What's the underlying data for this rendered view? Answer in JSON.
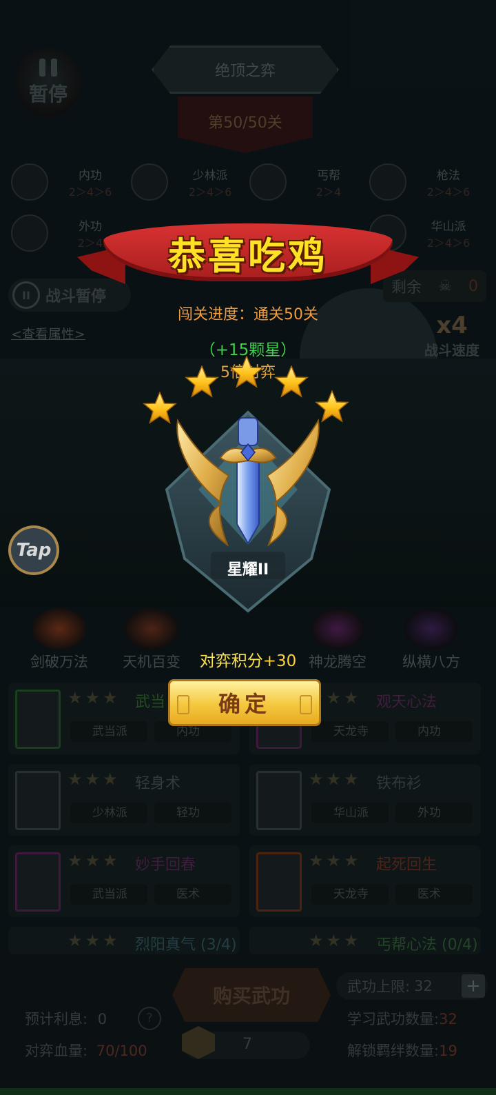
{
  "header": {
    "pause_label": "暂停",
    "mode_title": "绝顶之弈",
    "level": "第50/50关"
  },
  "bonds": [
    {
      "name": "内功",
      "levels": "2＞4＞6"
    },
    {
      "name": "少林派",
      "levels": "2＞4＞6"
    },
    {
      "name": "丐帮",
      "levels": "2＞4"
    },
    {
      "name": "枪法",
      "levels": "2＞4＞6"
    },
    {
      "name": "外功",
      "levels": "2＞4"
    },
    {
      "name": "华山派",
      "levels": "2＞4＞6"
    }
  ],
  "battle": {
    "pause_label": "战斗暂停",
    "view_attributes": "<查看属性>",
    "remaining_label": "剩余",
    "remaining_value": "0",
    "speed_value": "x4",
    "speed_label": "战斗速度",
    "tap_label": "Tap"
  },
  "skills": [
    {
      "name": "剑破万法",
      "color": "#6a3018"
    },
    {
      "name": "天机百变",
      "color": "#5a2a1a"
    },
    {
      "name": "神龙腾空",
      "color": "#4a1e4e"
    },
    {
      "name": "纵横八方",
      "color": "#36204e"
    }
  ],
  "cards": [
    {
      "title": "武当",
      "title_color": "#2a5a2a",
      "tags": [
        "武当派",
        "内功"
      ]
    },
    {
      "title": "观天心法",
      "title_color": "#4a2448",
      "tags": [
        "天龙寺",
        "内功"
      ]
    },
    {
      "title": "轻身术",
      "title_color": "#3a4445",
      "tags": [
        "少林派",
        "轻功"
      ]
    },
    {
      "title": "铁布衫",
      "title_color": "#3a4445",
      "tags": [
        "华山派",
        "外功"
      ]
    },
    {
      "title": "妙手回春",
      "title_color": "#4a2448",
      "tags": [
        "武当派",
        "医术"
      ]
    },
    {
      "title": "起死回生",
      "title_color": "#5a2a1e",
      "tags": [
        "天龙寺",
        "医术"
      ]
    },
    {
      "title": "烈阳真气 (3/4)",
      "title_color": "#2a4a50"
    },
    {
      "title": "丐帮心法 (0/4)",
      "title_color": "#2a5030"
    }
  ],
  "bottom": {
    "buy_label": "购买武功",
    "limit_label": "武功上限:",
    "limit_value": "32",
    "interest_label": "预计利息:",
    "interest_value": "0",
    "help_icon_label": "?",
    "hp_label": "对弈血量:",
    "hp_value": "70/100",
    "coins": "7",
    "learned_label": "学习武功数量:",
    "learned_value": "32",
    "bonds_label": "解锁羁绊数量:",
    "bonds_value": "19"
  },
  "result": {
    "banner": "恭喜吃鸡",
    "progress": "闯关进度：通关50关",
    "stars_gained": "（+15颗星）",
    "multiplier": "5倍对弈",
    "stars_count": 5,
    "rank_name": "星耀II",
    "score_label": "对弈积分",
    "score_value": "+30",
    "confirm_label": "确定"
  },
  "colors": {
    "ribbon": "#c82828",
    "banner_text": "#ffe226",
    "progress": "#f39a3a",
    "stars_gained": "#3fd24a",
    "star": "#ffc21a",
    "confirm_button": "#f4c83e"
  }
}
